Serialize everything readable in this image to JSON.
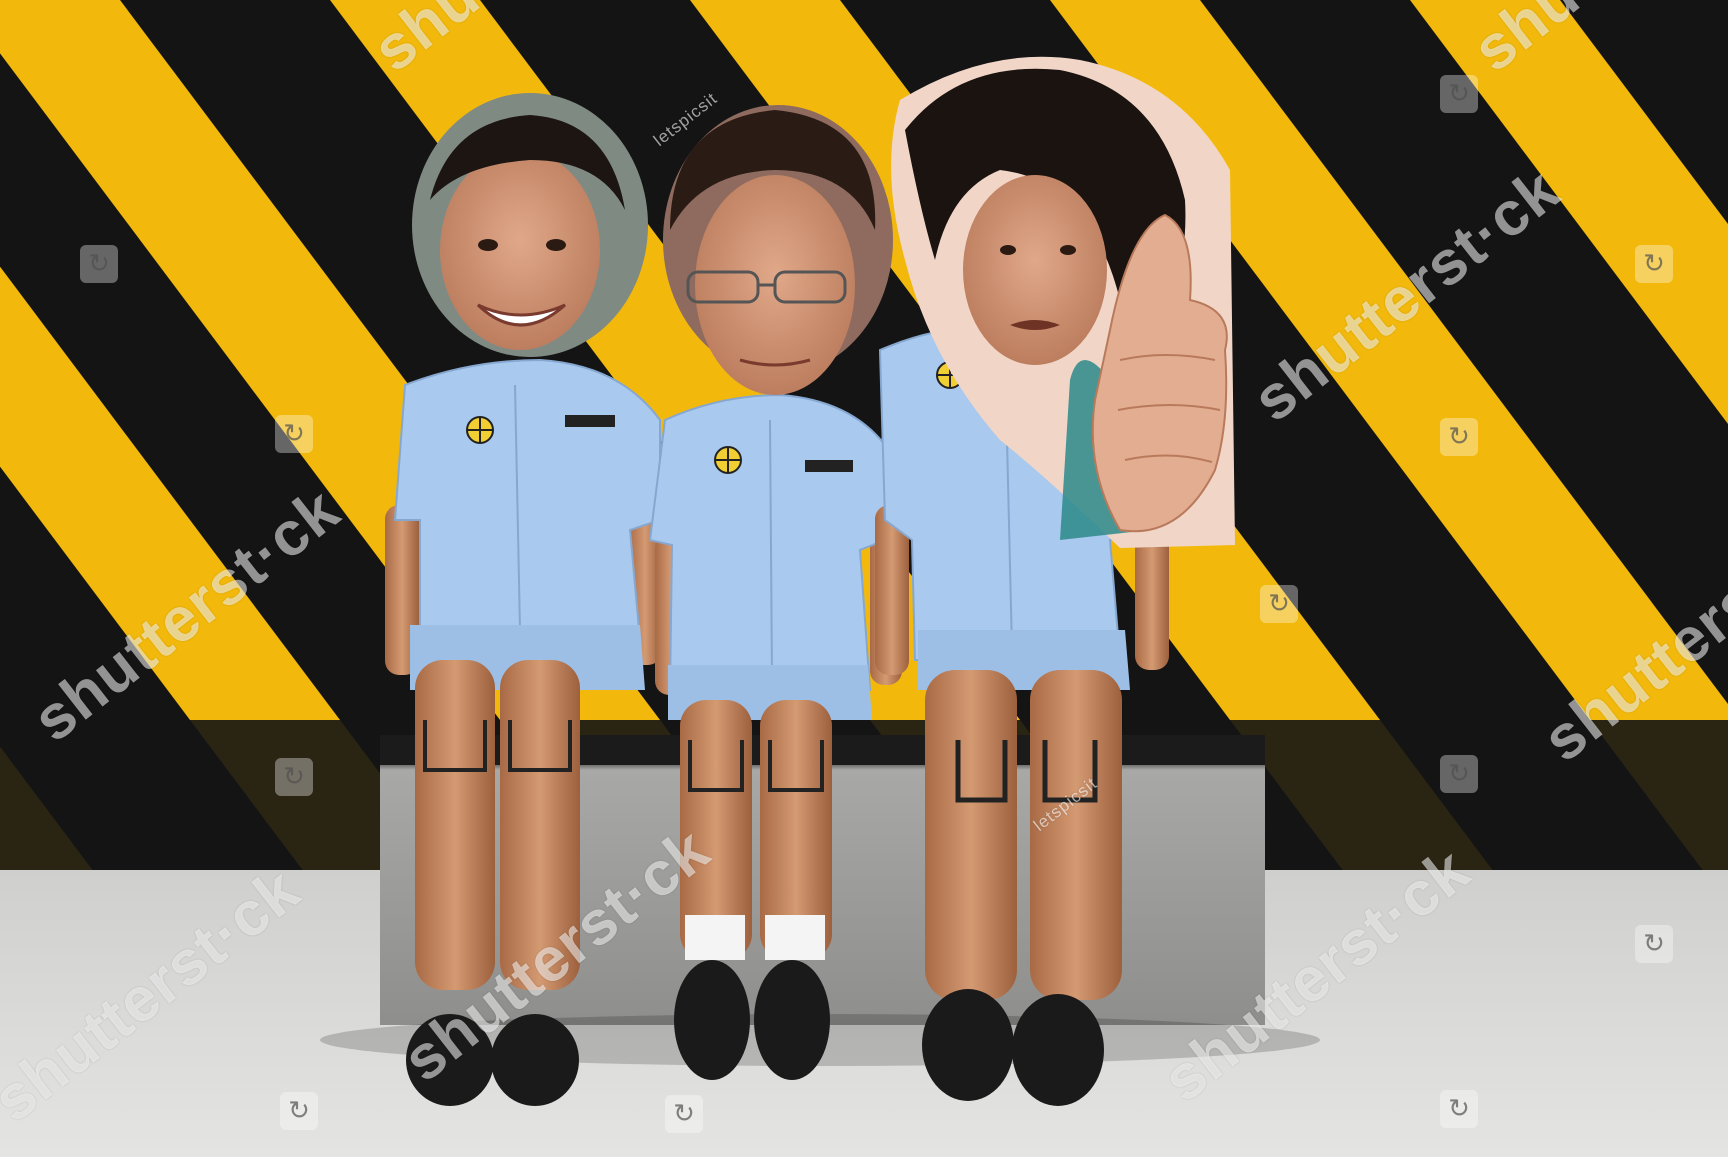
{
  "scene": {
    "description_colors": {
      "stripe_yellow": "#f2b90c",
      "stripe_black": "#141414",
      "floor": "#d8d8d6",
      "bench": "#2a2a2a",
      "shirt": "#a9c9ee",
      "skin": "#c98a62",
      "shoe": "#1a1a1a"
    }
  },
  "watermarks": {
    "big": [
      "shutterst·ck",
      "shutterst·ck",
      "shutterst·ck",
      "shutterst·ck",
      "shutterst·ck",
      "shutterst·ck",
      "shutterst·ck",
      "shutterst·ck"
    ],
    "small": [
      "letspicsit",
      "letspicsit"
    ]
  }
}
